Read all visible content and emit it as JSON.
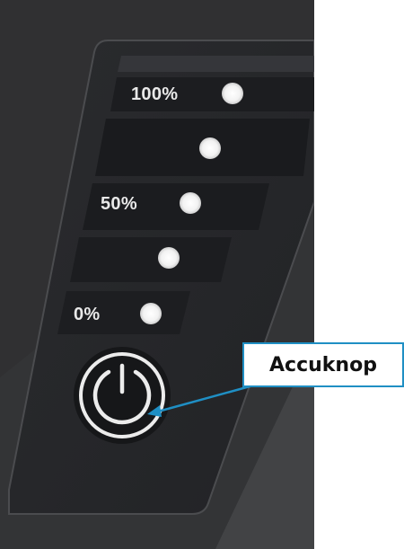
{
  "indicator_panel": {
    "levels": [
      {
        "label": "100%"
      },
      {
        "label": ""
      },
      {
        "label": "50%"
      },
      {
        "label": ""
      },
      {
        "label": "0%"
      }
    ],
    "power_icon": "power-icon"
  },
  "callout": {
    "text": "Accuknop",
    "border_color": "#1f8fc4",
    "arrow_color": "#1f8fc4"
  },
  "colors": {
    "panel_bg": "#26272a",
    "led": "#f2f2f2",
    "label_text": "#e9e9e9"
  }
}
